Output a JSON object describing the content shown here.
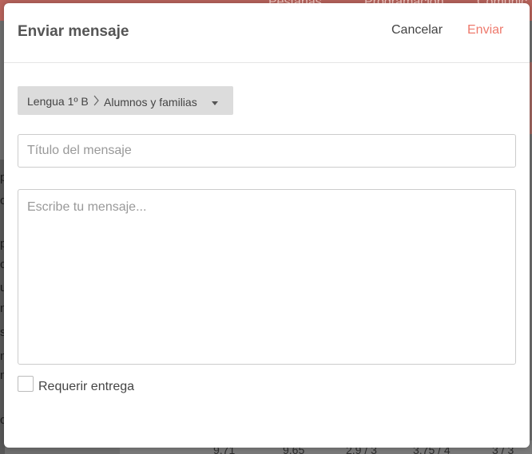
{
  "background": {
    "nav_items": [
      "Pestañas",
      "Programación",
      "Comunic"
    ],
    "table_cells": [
      "9,71",
      "9,65",
      "2,9 / 3",
      "3,75 / 4",
      "3 / 3"
    ],
    "left_letters": [
      "p",
      "c",
      "",
      "p",
      "c",
      "u",
      "",
      "n",
      "",
      "s",
      "n",
      "n",
      "",
      "c"
    ]
  },
  "modal": {
    "title": "Enviar mensaje",
    "cancel_label": "Cancelar",
    "send_label": "Enviar",
    "recipient": {
      "course": "Lengua 1º B",
      "audience": "Alumnos y familias"
    },
    "title_field": {
      "value": "",
      "placeholder": "Título del mensaje"
    },
    "message_field": {
      "value": "",
      "placeholder": "Escribe tu mensaje..."
    },
    "require_delivery": {
      "label": "Requerir entrega",
      "checked": false
    }
  },
  "colors": {
    "accent": "#ee7a6d",
    "backdrop": "#6e6e6e",
    "topbar": "#b9645c"
  }
}
